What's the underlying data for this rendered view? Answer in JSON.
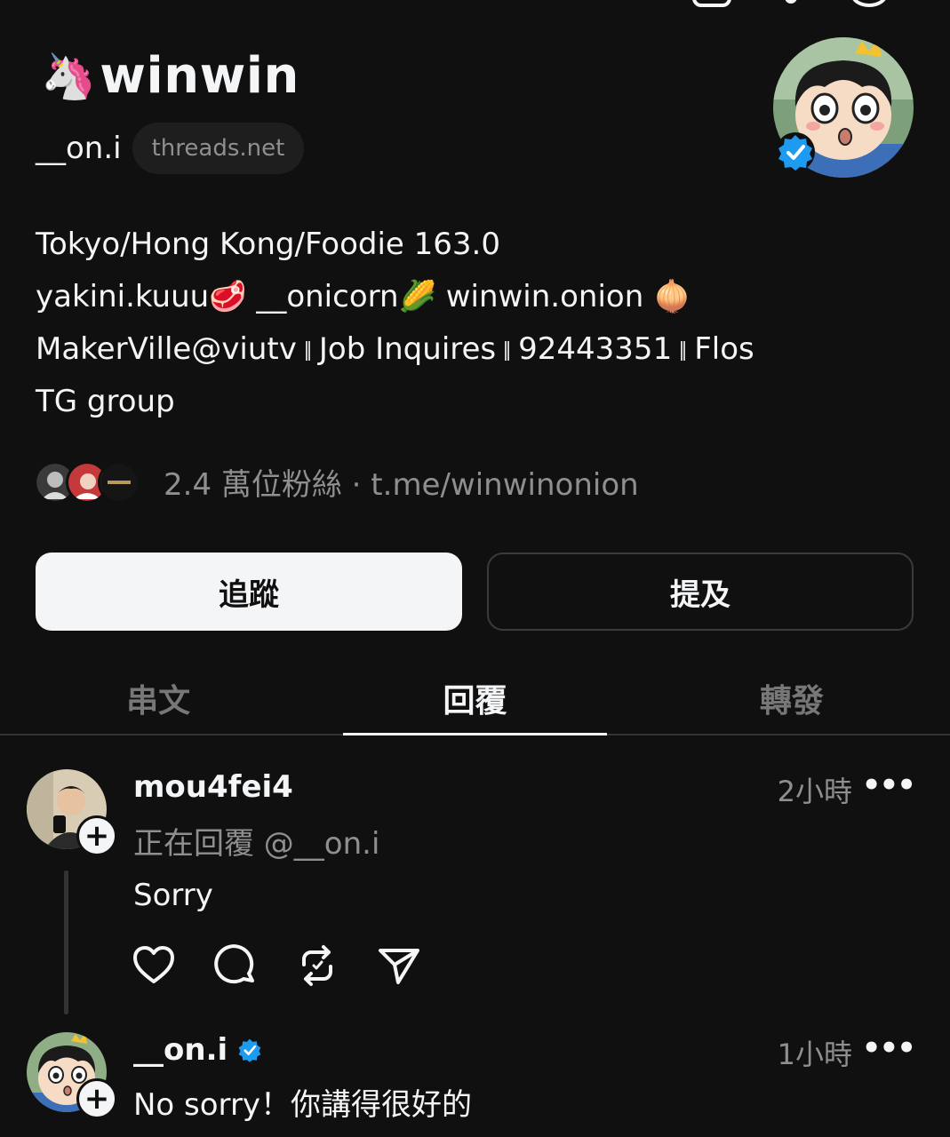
{
  "profile": {
    "emoji": "🦄",
    "display_name": "winwin",
    "handle": "__on.i",
    "domain_pill": "threads.net",
    "bio_lines": [
      "Tokyo/Hong Kong/Foodie 163.0",
      "yakini.kuuu🥩 __onicorn🌽 winwin.onion 🧅",
      "MakerVille@viutv",
      "Job Inquires",
      "92443351",
      "Flos",
      "TG group"
    ],
    "followers_text": "2.4 萬位粉絲 · t.me/winwinonion"
  },
  "actions": {
    "follow_label": "追蹤",
    "mention_label": "提及"
  },
  "tabs": [
    {
      "label": "串文",
      "active": false
    },
    {
      "label": "回覆",
      "active": true
    },
    {
      "label": "轉發",
      "active": false
    }
  ],
  "posts": [
    {
      "username": "mou4fei4",
      "time": "2小時",
      "more": "•••",
      "reply_to": "正在回覆 @__on.i",
      "body": "Sorry",
      "verified": false
    },
    {
      "username": "__on.i",
      "time": "1小時",
      "more": "•••",
      "body": "No sorry！你講得很好的",
      "verified": true
    }
  ],
  "colors": {
    "background": "#101010",
    "text": "#f3f5f7",
    "muted": "#8f8f8f",
    "verified": "#1d9bf0",
    "button_fill": "#f3f5f7",
    "border": "#3b3b3b"
  },
  "icons": [
    "unicorn-emoji",
    "verified-badge-icon",
    "plus-icon",
    "heart-icon",
    "comment-icon",
    "repost-icon",
    "share-icon",
    "more-icon"
  ]
}
